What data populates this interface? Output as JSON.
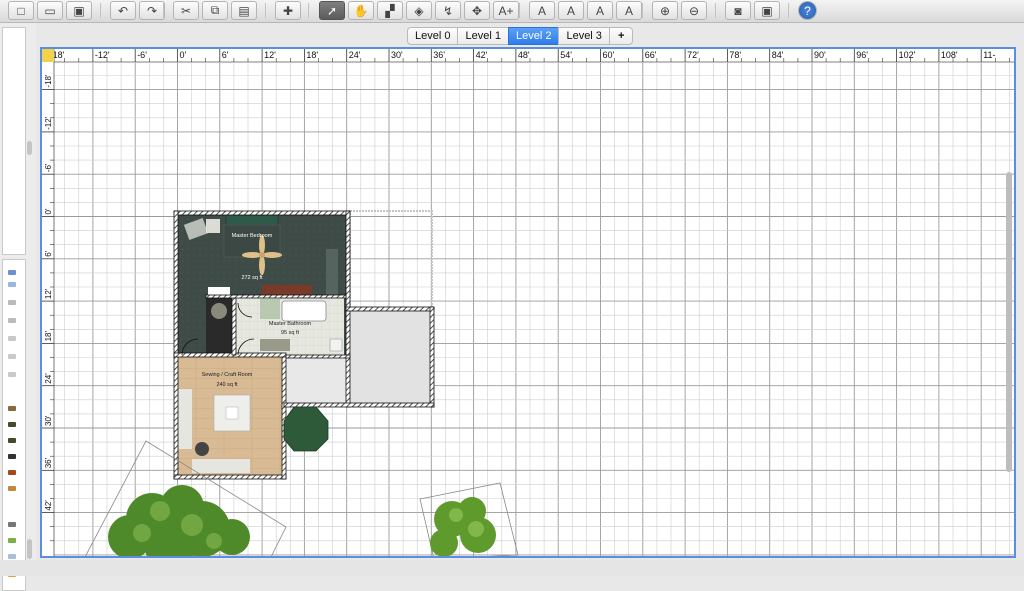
{
  "toolbar": {
    "buttons": [
      {
        "name": "new-home-icon",
        "glyph": "□",
        "sel": false
      },
      {
        "name": "open-icon",
        "glyph": "▭",
        "sel": false
      },
      {
        "name": "save-icon",
        "glyph": "▣",
        "sel": false
      },
      {
        "name": "undo-icon",
        "glyph": "↶",
        "sel": false
      },
      {
        "name": "redo-icon",
        "glyph": "↷",
        "sel": false
      },
      {
        "name": "cut-icon",
        "glyph": "✂",
        "sel": false
      },
      {
        "name": "copy-icon",
        "glyph": "⧉",
        "sel": false
      },
      {
        "name": "paste-icon",
        "glyph": "▤",
        "sel": false
      },
      {
        "name": "add-furniture-icon",
        "glyph": "✚",
        "sel": false
      },
      {
        "name": "select-mode-icon",
        "glyph": "➚",
        "sel": true
      },
      {
        "name": "pan-mode-icon",
        "glyph": "✋",
        "sel": false
      },
      {
        "name": "create-walls-icon",
        "glyph": "▞",
        "sel": false
      },
      {
        "name": "create-rooms-icon",
        "glyph": "◈",
        "sel": false
      },
      {
        "name": "create-polylines-icon",
        "glyph": "↯",
        "sel": false
      },
      {
        "name": "create-dimensions-icon",
        "glyph": "✥",
        "sel": false
      },
      {
        "name": "add-text-icon",
        "glyph": "A+",
        "sel": false
      },
      {
        "name": "text-style-a1-icon",
        "glyph": "A",
        "sel": false
      },
      {
        "name": "text-style-a2-icon",
        "glyph": "A",
        "sel": false
      },
      {
        "name": "text-bold-icon",
        "glyph": "A",
        "sel": false
      },
      {
        "name": "text-italic-icon",
        "glyph": "A",
        "sel": false
      },
      {
        "name": "zoom-in-icon",
        "glyph": "⊕",
        "sel": false
      },
      {
        "name": "zoom-out-icon",
        "glyph": "⊖",
        "sel": false
      },
      {
        "name": "create-photo-icon",
        "glyph": "◙",
        "sel": false
      },
      {
        "name": "create-video-icon",
        "glyph": "▣",
        "sel": false
      },
      {
        "name": "help-icon",
        "glyph": "?",
        "sel": false
      }
    ]
  },
  "levels": {
    "tabs": [
      "Level 0",
      "Level 1",
      "Level 2",
      "Level 3"
    ],
    "active": "Level 2",
    "add_glyph": "+"
  },
  "ruler": {
    "top_labels": [
      "18'",
      "-12'",
      "-6'",
      "0'",
      "6'",
      "12'",
      "18'",
      "24'",
      "30'",
      "36'",
      "42'",
      "48'",
      "54'",
      "60'",
      "66'",
      "72'",
      "78'",
      "84'",
      "90'",
      "96'",
      "102'",
      "108'",
      "11-"
    ],
    "left_labels": [
      "-18'",
      "-12'",
      "-6'",
      "0'",
      "6'",
      "12'",
      "18'",
      "24'",
      "30'",
      "36'",
      "42'"
    ]
  },
  "rooms": [
    {
      "name": "Master Bedroom",
      "area": "272 sq ft"
    },
    {
      "name": "Master Bathroom",
      "area": "95 sq ft"
    },
    {
      "name": "Sewing / Craft Room",
      "area": "240 sq ft"
    }
  ],
  "colors": {
    "bedroom_floor": "#3f4b47",
    "bathroom_floor": "#e2e5dc",
    "craft_floor": "#d7b993",
    "grid": "#bdbdbd",
    "wall_hatch": "#222222",
    "selection": "#5b8de0"
  }
}
